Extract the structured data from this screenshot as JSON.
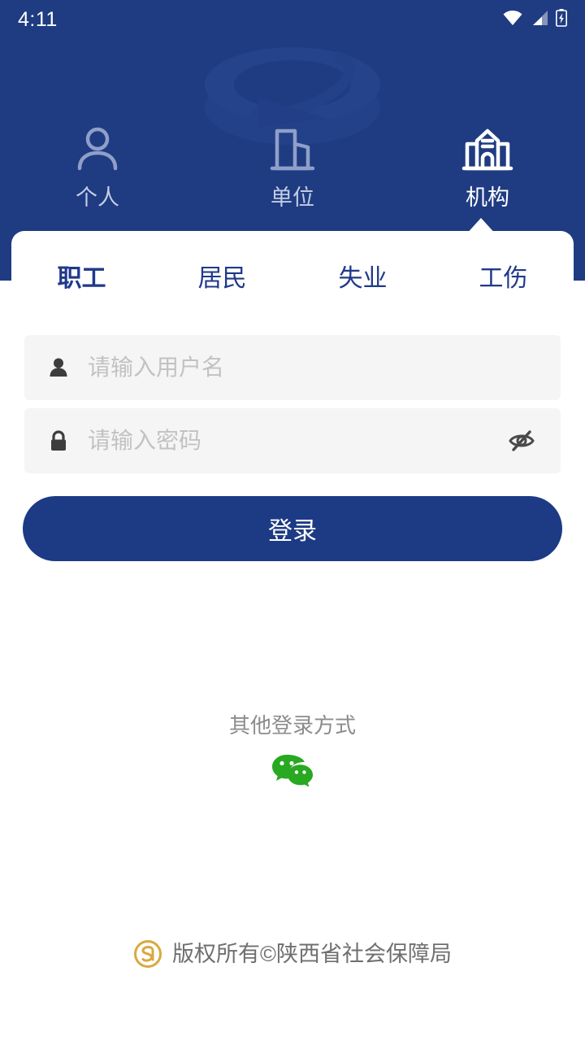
{
  "status_bar": {
    "time": "4:11",
    "icons": [
      "wifi-icon",
      "cellular-signal-icon",
      "battery-charging-icon"
    ]
  },
  "theme": {
    "header_blue": "#1f3c82",
    "button_blue": "#1d3a84",
    "tab_blue": "#20398a",
    "input_bg": "#f5f5f5",
    "wechat_green": "#29a821",
    "footer_logo_gold": "#d8a93f"
  },
  "role_tabs": [
    {
      "label": "个人",
      "icon": "person-outline-icon",
      "active": false
    },
    {
      "label": "单位",
      "icon": "office-building-icon",
      "active": false
    },
    {
      "label": "机构",
      "icon": "institution-building-icon",
      "active": true
    }
  ],
  "sub_tabs": [
    {
      "label": "职工",
      "active": true
    },
    {
      "label": "居民",
      "active": false
    },
    {
      "label": "失业",
      "active": false
    },
    {
      "label": "工伤",
      "active": false
    }
  ],
  "form": {
    "username": {
      "icon": "person-filled-icon",
      "placeholder": "请输入用户名",
      "value": ""
    },
    "password": {
      "icon": "lock-icon",
      "placeholder": "请输入密码",
      "value": "",
      "toggle_icon": "eye-slash-icon",
      "visible": false
    },
    "submit_label": "登录"
  },
  "other_login": {
    "label": "其他登录方式",
    "methods": [
      {
        "name": "wechat",
        "icon": "wechat-icon"
      }
    ]
  },
  "footer": {
    "logo": "social-insurance-logo",
    "text": "版权所有©陕西省社会保障局"
  }
}
